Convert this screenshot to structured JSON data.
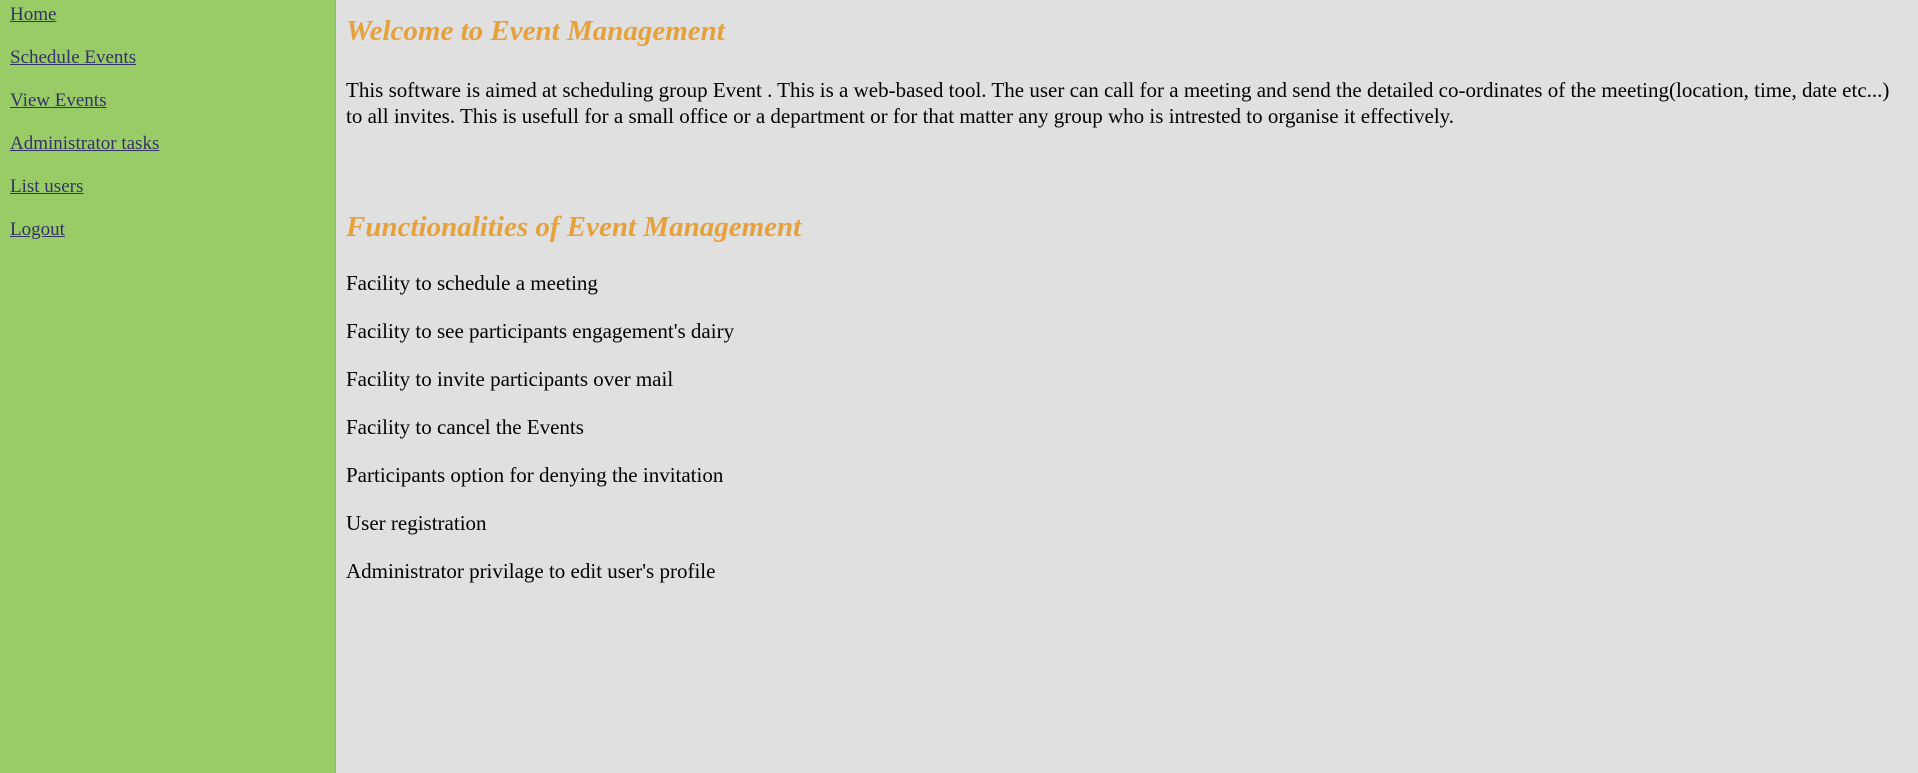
{
  "sidebar": {
    "links": [
      {
        "label": "Home"
      },
      {
        "label": "Schedule Events"
      },
      {
        "label": "View Events"
      },
      {
        "label": "Administrator tasks"
      },
      {
        "label": "List users"
      },
      {
        "label": "Logout"
      }
    ]
  },
  "main": {
    "welcome_heading": "Welcome to Event Management",
    "intro": "This software is aimed at scheduling group Event . This is a web-based tool. The user can call for a meeting and send the detailed co-ordinates of the meeting(location, time, date etc...) to all invites. This is usefull for a small office or a department or for that matter any group who is intrested to organise it effectively.",
    "functionalities_heading": "Functionalities of Event Management",
    "features": [
      "Facility to schedule a meeting",
      "Facility to see participants engagement's dairy",
      "Facility to invite participants over mail",
      "Facility to cancel the Events",
      "Participants option for denying the invitation",
      "User registration",
      "Administrator privilage to edit user's profile"
    ]
  },
  "colors": {
    "sidebar_bg": "#99cc66",
    "main_bg": "#e0e0e0",
    "heading": "#e6a13a",
    "link": "#333366"
  }
}
